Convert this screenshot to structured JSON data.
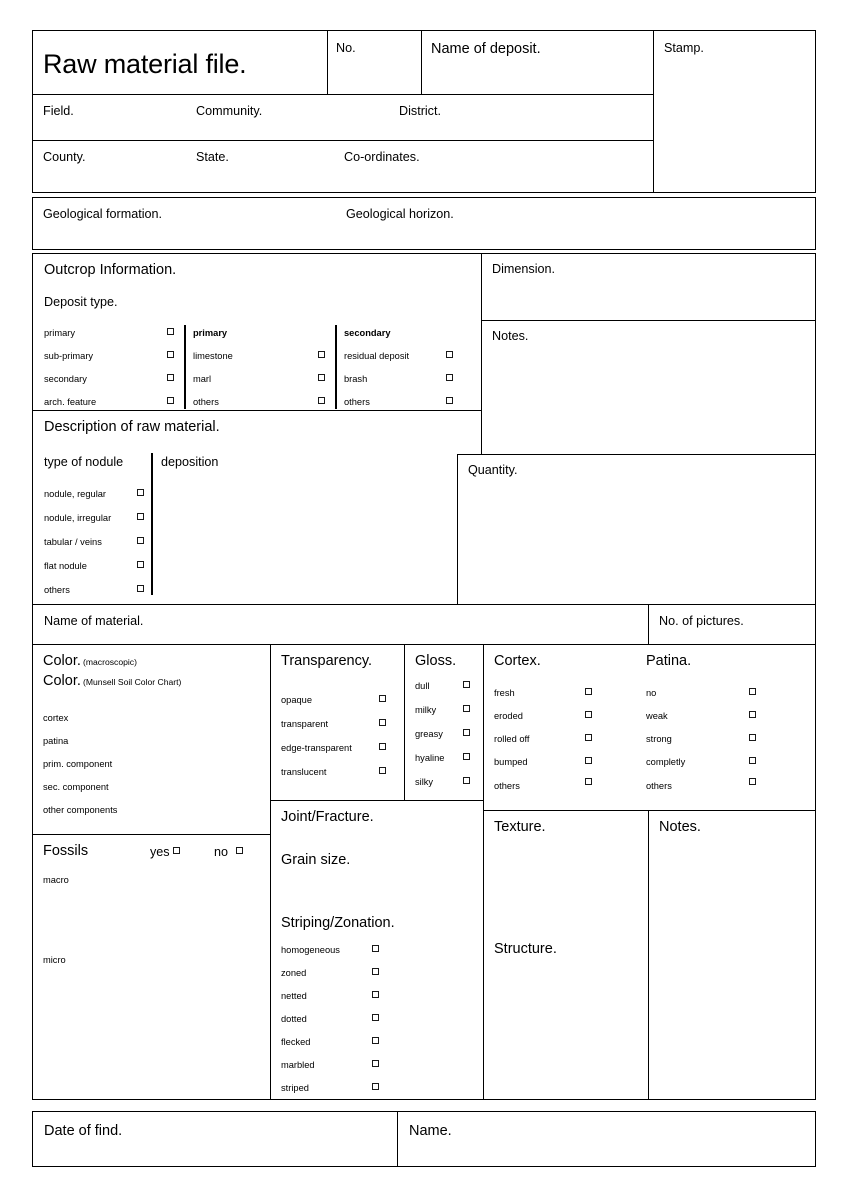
{
  "form": {
    "title": "Raw material file.",
    "header": {
      "no": "No.",
      "name_of_deposit": "Name of deposit.",
      "stamp": "Stamp.",
      "field": "Field.",
      "community": "Community.",
      "district": "District.",
      "county": "County.",
      "state": "State.",
      "coordinates": "Co-ordinates.",
      "geological_formation": "Geological formation.",
      "geological_horizon": "Geological horizon."
    },
    "outcrop": {
      "heading": "Outcrop Information.",
      "deposit_type_label": "Deposit type.",
      "col1": {
        "items": [
          {
            "label": "primary",
            "bold": false
          },
          {
            "label": "sub-primary",
            "bold": false
          },
          {
            "label": "secondary",
            "bold": false
          },
          {
            "label": "arch. feature",
            "bold": false
          }
        ]
      },
      "col2": {
        "header": "primary",
        "items": [
          {
            "label": "limestone"
          },
          {
            "label": "marl"
          },
          {
            "label": "others"
          }
        ]
      },
      "col3": {
        "header": "secondary",
        "items": [
          {
            "label": "residual deposit"
          },
          {
            "label": "brash"
          },
          {
            "label": "others"
          }
        ]
      }
    },
    "dimension": "Dimension.",
    "notes_top": "Notes.",
    "description": {
      "heading": "Description of raw material.",
      "type_of_nodule": "type of nodule",
      "deposition": "deposition",
      "items": [
        {
          "label": "nodule, regular"
        },
        {
          "label": "nodule, irregular"
        },
        {
          "label": "tabular / veins"
        },
        {
          "label": "flat nodule"
        },
        {
          "label": "others"
        }
      ]
    },
    "quantity": "Quantity.",
    "name_of_material": "Name of material.",
    "no_of_pictures": "No. of pictures.",
    "color": {
      "label1": "Color.",
      "sub1": "(macroscopic)",
      "label2": "Color.",
      "sub2": "(Munsell Soil Color Chart)",
      "rows": [
        {
          "label": "cortex"
        },
        {
          "label": "patina"
        },
        {
          "label": "prim. component"
        },
        {
          "label": "sec. component"
        },
        {
          "label": "other components"
        }
      ]
    },
    "transparency": {
      "heading": "Transparency.",
      "items": [
        {
          "label": "opaque"
        },
        {
          "label": "transparent"
        },
        {
          "label": "edge-transparent"
        },
        {
          "label": "translucent"
        }
      ]
    },
    "gloss": {
      "heading": "Gloss.",
      "items": [
        {
          "label": "dull"
        },
        {
          "label": "milky"
        },
        {
          "label": "greasy"
        },
        {
          "label": "hyaline"
        },
        {
          "label": "silky"
        }
      ]
    },
    "cortex": {
      "heading": "Cortex.",
      "items": [
        {
          "label": "fresh"
        },
        {
          "label": "eroded"
        },
        {
          "label": "rolled off"
        },
        {
          "label": "bumped"
        },
        {
          "label": "others"
        }
      ]
    },
    "patina": {
      "heading": "Patina.",
      "items": [
        {
          "label": "no"
        },
        {
          "label": "weak"
        },
        {
          "label": "strong"
        },
        {
          "label": "completly"
        },
        {
          "label": "others"
        }
      ]
    },
    "fossils": {
      "heading": "Fossils",
      "yes": "yes",
      "no": "no",
      "macro": "macro",
      "micro": "micro"
    },
    "joint_fracture": "Joint/Fracture.",
    "grain_size": "Grain size.",
    "striping": {
      "heading": "Striping/Zonation.",
      "items": [
        {
          "label": "homogeneous"
        },
        {
          "label": "zoned"
        },
        {
          "label": "netted"
        },
        {
          "label": "dotted"
        },
        {
          "label": "flecked"
        },
        {
          "label": "marbled"
        },
        {
          "label": "striped"
        }
      ]
    },
    "texture": "Texture.",
    "structure": "Structure.",
    "notes_bottom": "Notes.",
    "footer": {
      "date_of_find": "Date of find.",
      "name": "Name."
    }
  },
  "colors": {
    "ink": "#000000",
    "paper": "#ffffff"
  }
}
